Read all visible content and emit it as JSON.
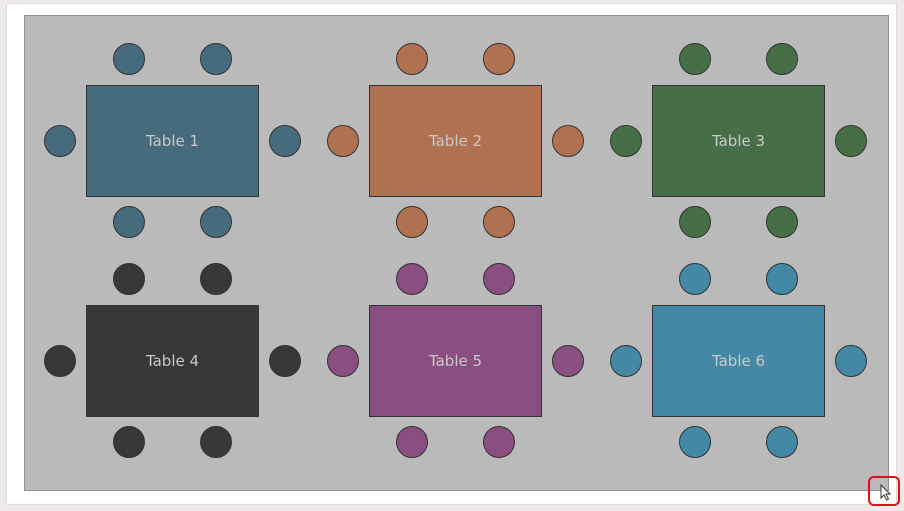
{
  "tables": [
    {
      "label": "Table 1",
      "color": "#456b7c"
    },
    {
      "label": "Table 2",
      "color": "#b07150"
    },
    {
      "label": "Table 3",
      "color": "#466f48"
    },
    {
      "label": "Table 4",
      "color": "#383838"
    },
    {
      "label": "Table 5",
      "color": "#8a4f80"
    },
    {
      "label": "Table 6",
      "color": "#4389a5"
    }
  ],
  "chairs_per_table": 6,
  "highlight_color": "#e0101a"
}
